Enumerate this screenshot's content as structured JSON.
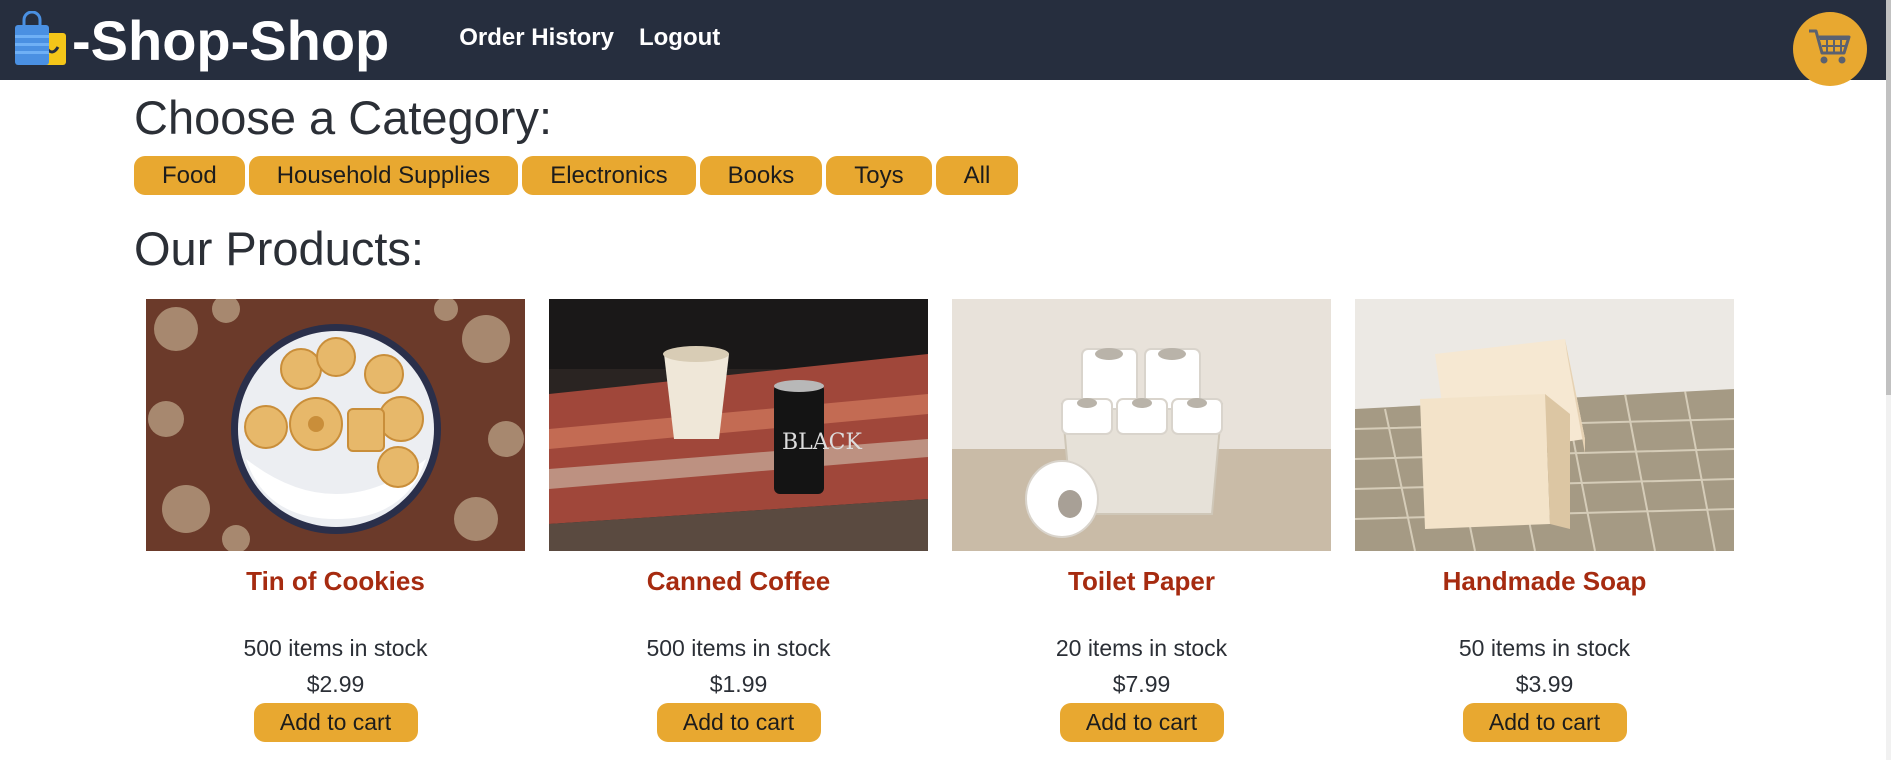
{
  "header": {
    "brand_title": "-Shop-Shop",
    "brand_icon": "shopping-bags-icon",
    "nav": [
      {
        "label": "Order History"
      },
      {
        "label": "Logout"
      }
    ],
    "cart_icon": "shopping-cart-icon"
  },
  "categories": {
    "heading": "Choose a Category:",
    "items": [
      {
        "label": "Food"
      },
      {
        "label": "Household Supplies"
      },
      {
        "label": "Electronics"
      },
      {
        "label": "Books"
      },
      {
        "label": "Toys"
      },
      {
        "label": "All"
      }
    ]
  },
  "products": {
    "heading": "Our Products:",
    "items": [
      {
        "name": "Tin of Cookies",
        "stock": "500 items in stock",
        "price": "$2.99",
        "button": "Add to cart",
        "image": "cookies-photo"
      },
      {
        "name": "Canned Coffee",
        "stock": "500 items in stock",
        "price": "$1.99",
        "button": "Add to cart",
        "image": "coffee-photo"
      },
      {
        "name": "Toilet Paper",
        "stock": "20 items in stock",
        "price": "$7.99",
        "button": "Add to cart",
        "image": "toilet-paper-photo"
      },
      {
        "name": "Handmade Soap",
        "stock": "50 items in stock",
        "price": "$3.99",
        "button": "Add to cart",
        "image": "soap-photo"
      }
    ]
  },
  "colors": {
    "navbar": "#262e3e",
    "accent": "#e8a830",
    "product_name": "#a62b10",
    "text": "#2b2f36"
  }
}
